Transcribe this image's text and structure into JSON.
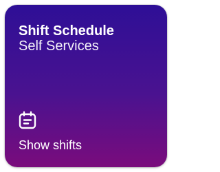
{
  "tile": {
    "title": "Shift Schedule",
    "subtitle": "Self Services",
    "footer_label": "Show shifts",
    "icon": "calendar-icon"
  },
  "colors": {
    "gradient_top": "#2e0f96",
    "gradient_bottom": "#7a0c7c",
    "text": "#ffffff"
  }
}
